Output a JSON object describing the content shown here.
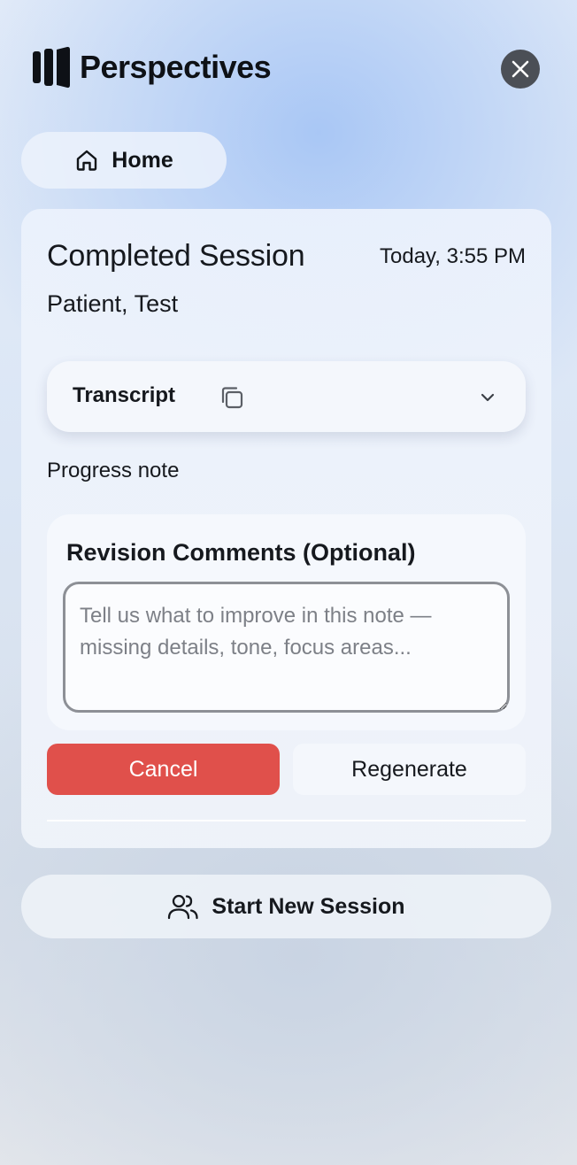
{
  "app": {
    "name": "Perspectives",
    "logo_icon": "perspectives-logo-icon",
    "close_icon": "close-icon"
  },
  "nav": {
    "home_label": "Home",
    "home_icon": "home-icon"
  },
  "session": {
    "title": "Completed Session",
    "time": "Today, 3:55 PM",
    "patient": "Patient, Test"
  },
  "transcript": {
    "label": "Transcript",
    "copy_icon": "copy-icon",
    "expand_icon": "chevron-down-icon"
  },
  "note": {
    "label": "Progress note"
  },
  "revision": {
    "title": "Revision Comments (Optional)",
    "value": "",
    "placeholder": "Tell us what to improve in this note — missing details, tone, focus areas..."
  },
  "actions": {
    "cancel_label": "Cancel",
    "regenerate_label": "Regenerate"
  },
  "footer": {
    "new_session_label": "Start New Session",
    "new_session_icon": "users-icon"
  },
  "colors": {
    "accent_danger": "#e0504b",
    "close_button": "#4b4f56",
    "background_accent": "#a9c7f5"
  }
}
